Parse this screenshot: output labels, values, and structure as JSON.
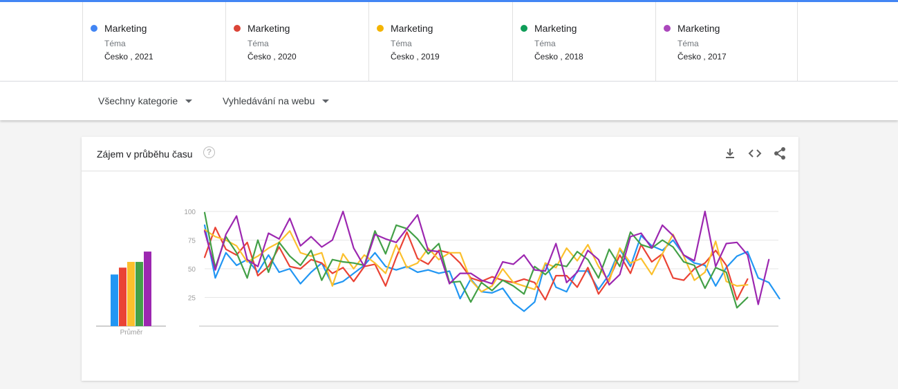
{
  "compare": {
    "terms": [
      {
        "name": "Marketing",
        "type": "Téma",
        "geo": "Česko , 2021",
        "color": "#4285f4"
      },
      {
        "name": "Marketing",
        "type": "Téma",
        "geo": "Česko , 2020",
        "color": "#db4437"
      },
      {
        "name": "Marketing",
        "type": "Téma",
        "geo": "Česko , 2019",
        "color": "#f4b400"
      },
      {
        "name": "Marketing",
        "type": "Téma",
        "geo": "Česko , 2018",
        "color": "#0f9d58"
      },
      {
        "name": "Marketing",
        "type": "Téma",
        "geo": "Česko , 2017",
        "color": "#ab47bc"
      }
    ]
  },
  "filters": {
    "category": "Všechny kategorie",
    "search_type": "Vyhledávání na webu"
  },
  "card": {
    "title": "Zájem v průběhu času",
    "help_glyph": "?",
    "actions": [
      "download-icon",
      "embed-icon",
      "share-icon"
    ]
  },
  "chart_data": {
    "type": "line",
    "ylim": [
      0,
      100
    ],
    "yticks": [
      25,
      50,
      75,
      100
    ],
    "grid": true,
    "legend": "top",
    "average_label": "Průměr",
    "averages": [
      {
        "name": "Marketing",
        "value": 45,
        "color": "#2196f3"
      },
      {
        "name": "Marketing",
        "value": 51,
        "color": "#ea4335"
      },
      {
        "name": "Marketing",
        "value": 56,
        "color": "#fbc02d"
      },
      {
        "name": "Marketing",
        "value": 56,
        "color": "#43a047"
      },
      {
        "name": "Marketing",
        "value": 65,
        "color": "#9c27b0"
      }
    ],
    "series": [
      {
        "name": "Marketing",
        "color": "#2196f3",
        "values": [
          88,
          42,
          64,
          53,
          58,
          47,
          62,
          47,
          50,
          37,
          47,
          55,
          36,
          39,
          46,
          53,
          64,
          52,
          49,
          52,
          47,
          49,
          46,
          48,
          24,
          41,
          30,
          29,
          33,
          20,
          13,
          21,
          55,
          34,
          30,
          48,
          48,
          32,
          45,
          67,
          52,
          79,
          70,
          66,
          75,
          62,
          55,
          53,
          35,
          51,
          61,
          65,
          42,
          38,
          24
        ]
      },
      {
        "name": "Marketing",
        "color": "#ea4335",
        "values": [
          60,
          86,
          67,
          62,
          73,
          44,
          52,
          69,
          52,
          50,
          58,
          55,
          46,
          51,
          39,
          52,
          54,
          35,
          60,
          82,
          59,
          54,
          66,
          64,
          55,
          42,
          39,
          43,
          40,
          38,
          41,
          38,
          23,
          44,
          44,
          34,
          51,
          28,
          41,
          62,
          46,
          71,
          56,
          63,
          42,
          40,
          50,
          55,
          66,
          53,
          23,
          41
        ]
      },
      {
        "name": "Marketing",
        "color": "#fbc02d",
        "values": [
          84,
          78,
          75,
          70,
          56,
          61,
          68,
          73,
          83,
          64,
          61,
          64,
          35,
          63,
          50,
          62,
          55,
          46,
          71,
          51,
          55,
          68,
          58,
          64,
          64,
          40,
          30,
          35,
          50,
          38,
          35,
          32,
          55,
          51,
          68,
          57,
          71,
          52,
          39,
          68,
          55,
          59,
          45,
          63,
          80,
          61,
          40,
          47,
          74,
          39,
          35,
          36
        ]
      },
      {
        "name": "Marketing",
        "color": "#43a047",
        "values": [
          99,
          51,
          78,
          64,
          42,
          75,
          47,
          73,
          61,
          53,
          66,
          40,
          58,
          56,
          55,
          53,
          83,
          63,
          88,
          85,
          76,
          63,
          72,
          38,
          39,
          21,
          38,
          31,
          40,
          35,
          28,
          52,
          45,
          54,
          52,
          65,
          58,
          42,
          67,
          52,
          82,
          71,
          68,
          75,
          69,
          56,
          53,
          33,
          51,
          47,
          16,
          25
        ]
      },
      {
        "name": "Marketing",
        "color": "#9c27b0",
        "values": [
          83,
          49,
          80,
          96,
          58,
          52,
          81,
          76,
          94,
          70,
          78,
          69,
          75,
          100,
          68,
          52,
          80,
          76,
          73,
          85,
          97,
          66,
          65,
          37,
          46,
          46,
          40,
          37,
          56,
          54,
          62,
          49,
          48,
          72,
          38,
          47,
          66,
          58,
          36,
          45,
          78,
          81,
          68,
          88,
          79,
          62,
          57,
          100,
          52,
          72,
          73,
          62,
          19,
          58
        ]
      }
    ]
  }
}
